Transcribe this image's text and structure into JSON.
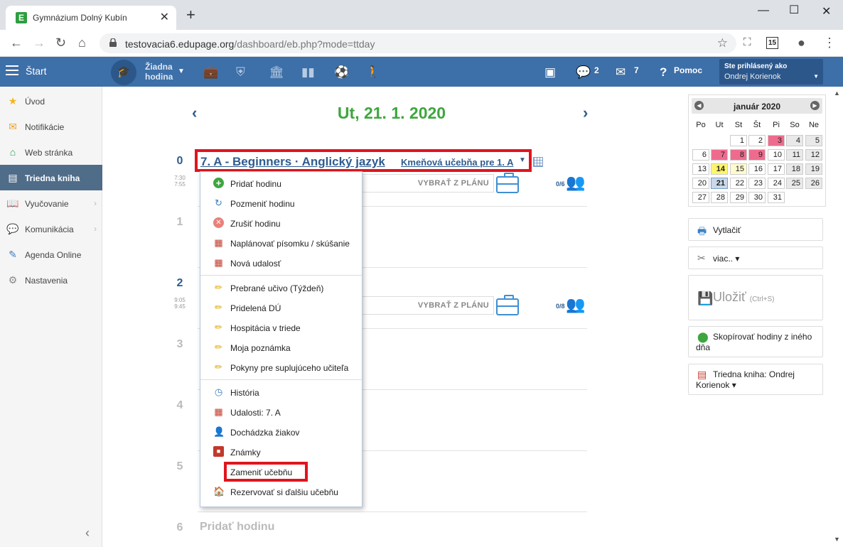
{
  "browser": {
    "tab_title": "Gymnázium Dolný Kubín",
    "favicon_letter": "E",
    "url_host": "testovacia6.edupage.org",
    "url_path": "/dashboard/eb.php?mode=ttday",
    "ext_badge": "15"
  },
  "header": {
    "start_label": "Štart",
    "no_lesson_1": "Žiadna",
    "no_lesson_2": "hodina",
    "chat_count": "2",
    "mail_count": "7",
    "help_label": "Pomoc",
    "user_line1": "Ste prihlásený ako",
    "user_line2": "Ondrej Korienok"
  },
  "sidebar": {
    "items": [
      {
        "label": "Úvod",
        "icon": "star-icon"
      },
      {
        "label": "Notifikácie",
        "icon": "envelope-icon"
      },
      {
        "label": "Web stránka",
        "icon": "house-icon"
      },
      {
        "label": "Triedna kniha",
        "icon": "book-icon",
        "active": true
      },
      {
        "label": "Vyučovanie",
        "icon": "open-book-icon"
      },
      {
        "label": "Komunikácia",
        "icon": "chat-icon"
      },
      {
        "label": "Agenda Online",
        "icon": "pen-icon"
      },
      {
        "label": "Nastavenia",
        "icon": "gear-icon"
      }
    ]
  },
  "main": {
    "date": "Ut, 21. 1. 2020",
    "lesson_title": "7. A - Beginners · Anglický jazyk",
    "room": "Kmeňová učebňa pre 1. A",
    "plan_label": "VYBRAŤ Z PLÁNU",
    "lessons": [
      {
        "num": "0",
        "time_from": "7:30",
        "time_to": "7:55",
        "count": "0/6"
      },
      {
        "num": "1"
      },
      {
        "num": "2",
        "time_from": "9:05",
        "time_to": "9:45",
        "count": "0/8"
      },
      {
        "num": "3"
      },
      {
        "num": "4"
      },
      {
        "num": "5"
      },
      {
        "num": "6"
      }
    ],
    "add_lesson": "Pridať hodinu"
  },
  "menu": {
    "items": [
      {
        "label": "Pridať hodinu",
        "icon": "plus-circle-icon"
      },
      {
        "label": "Pozmeniť hodinu",
        "icon": "refresh-icon"
      },
      {
        "label": "Zrušiť hodinu",
        "icon": "cancel-circle-icon"
      },
      {
        "label": "Naplánovať písomku / skúšanie",
        "icon": "calendar-icon"
      },
      {
        "label": "Nová udalosť",
        "icon": "calendar-icon"
      },
      {
        "label": "Prebrané učivo (Týždeň)",
        "icon": "pencil-icon"
      },
      {
        "label": "Pridelená DÚ",
        "icon": "pencil-icon"
      },
      {
        "label": "Hospitácia v triede",
        "icon": "pencil-icon"
      },
      {
        "label": "Moja poznámka",
        "icon": "pencil-icon"
      },
      {
        "label": "Pokyny pre suplujúceho učiteľa",
        "icon": "pencil-icon"
      },
      {
        "label": "História",
        "icon": "clock-icon"
      },
      {
        "label": "Udalosti: 7. A",
        "icon": "calendar-icon"
      },
      {
        "label": "Dochádzka žiakov",
        "icon": "person-icon"
      },
      {
        "label": "Známky",
        "icon": "grade-book-icon"
      },
      {
        "label": "Zameniť učebňu",
        "icon": ""
      },
      {
        "label": "Rezervovať si ďalšiu učebňu",
        "icon": "building-icon"
      }
    ]
  },
  "calendar": {
    "month": "január 2020",
    "dow": [
      "Po",
      "Ut",
      "St",
      "Št",
      "Pi",
      "So",
      "Ne"
    ],
    "weeks": [
      [
        "",
        "",
        "1",
        "2",
        "3",
        "4",
        "5"
      ],
      [
        "6",
        "7",
        "8",
        "9",
        "10",
        "11",
        "12"
      ],
      [
        "13",
        "14",
        "15",
        "16",
        "17",
        "18",
        "19"
      ],
      [
        "20",
        "21",
        "22",
        "23",
        "24",
        "25",
        "26"
      ],
      [
        "27",
        "28",
        "29",
        "30",
        "31",
        "",
        ""
      ]
    ],
    "colors": {
      "holiday": "#ef6b8d",
      "today": "#fff56a",
      "selected": "#c9d8ea"
    }
  },
  "right": {
    "print": "Vytlačiť",
    "more": "viac.. ▾",
    "save": "Uložiť",
    "save_hint": "(Ctrl+S)",
    "copy1": "Skopírovať hodiny z iného",
    "copy2": "dňa",
    "book1": "Triedna kniha: Ondrej",
    "book2": "Korienok ▾"
  }
}
